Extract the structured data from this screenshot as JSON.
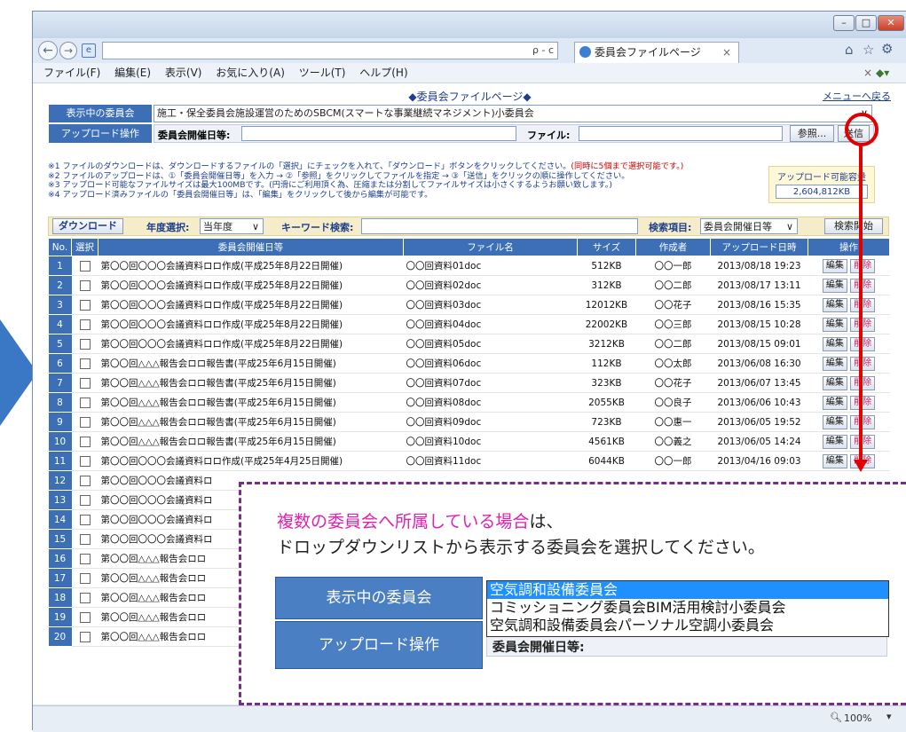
{
  "browser": {
    "tab_title": "委員会ファイルページ",
    "search_hint": "ρ - c",
    "menu": [
      "ファイル(F)",
      "編集(E)",
      "表示(V)",
      "お気に入り(A)",
      "ツール(T)",
      "ヘルプ(H)"
    ],
    "zoom": "100%"
  },
  "page": {
    "title": "◆委員会ファイルページ◆",
    "menu_link": "メニューへ戻る",
    "committee_label": "表示中の委員会",
    "committee_value": "施工・保全委員会施設運営のためのSBCM(スマートな事業継続マネジメント)小委員会",
    "upload_label": "アップロード操作",
    "meeting_date_label": "委員会開催日等:",
    "file_label": "ファイル:",
    "browse_button": "参照...",
    "send_button": "送信",
    "notes": [
      "※1 ファイルのダウンロードは、ダウンロードするファイルの「選択」にチェックを入れて、「ダウンロード」ボタンをクリックしてください。",
      "※2 ファイルのアップロードは、①「委員会開催日等」を入力 → ②「参照」をクリックしてファイルを指定 → ③「送信」をクリックの順に操作してください。",
      "※3 アップロード可能なファイルサイズは最大100MBです。(円滑にご利用頂く為、圧縮または分割してファイルサイズは小さくするようお願い致します。)",
      "※4 アップロード済みファイルの「委員会開催日等」は、「編集」をクリックして後から編集が可能です。"
    ],
    "note1_red": "(同時に5個まで選択可能です。)",
    "note3_red": "最大100MB",
    "capacity_label": "アップロード可能容量",
    "capacity_value": "2,604,812KB",
    "download_button": "ダウンロード",
    "year_label": "年度選択:",
    "year_value": "当年度",
    "keyword_label": "キーワード検索:",
    "search_item_label": "検索項目:",
    "search_item_value": "委員会開催日等",
    "search_button": "検索開始"
  },
  "table": {
    "headers": [
      "No.",
      "選択",
      "委員会開催日等",
      "ファイル名",
      "サイズ",
      "作成者",
      "アップロード日時",
      "操作"
    ],
    "edit_label": "編集",
    "delete_label": "削除",
    "rows": [
      {
        "no": "1",
        "title": "第〇〇回〇〇〇会議資料ロロ作成(平成25年8月22日開催)",
        "file": "〇〇回資料01doc",
        "size": "512KB",
        "author": "〇〇一郎",
        "date": "2013/08/18 19:23"
      },
      {
        "no": "2",
        "title": "第〇〇回〇〇〇会議資料ロロ作成(平成25年8月22日開催)",
        "file": "〇〇回資料02doc",
        "size": "312KB",
        "author": "〇〇二郎",
        "date": "2013/08/17 13:11"
      },
      {
        "no": "3",
        "title": "第〇〇回〇〇〇会議資料ロロ作成(平成25年8月22日開催)",
        "file": "〇〇回資料03doc",
        "size": "12012KB",
        "author": "〇〇花子",
        "date": "2013/08/16 15:35"
      },
      {
        "no": "4",
        "title": "第〇〇回〇〇〇会議資料ロロ作成(平成25年8月22日開催)",
        "file": "〇〇回資料04doc",
        "size": "22002KB",
        "author": "〇〇三郎",
        "date": "2013/08/15 10:28"
      },
      {
        "no": "5",
        "title": "第〇〇回〇〇〇会議資料ロロ作成(平成25年8月22日開催)",
        "file": "〇〇回資料05doc",
        "size": "3212KB",
        "author": "〇〇二郎",
        "date": "2013/08/15 09:01"
      },
      {
        "no": "6",
        "title": "第〇〇回△△△報告会ロロ報告書(平成25年6月15日開催)",
        "file": "〇〇回資料06doc",
        "size": "112KB",
        "author": "〇〇太郎",
        "date": "2013/06/08 16:30"
      },
      {
        "no": "7",
        "title": "第〇〇回△△△報告会ロロ報告書(平成25年6月15日開催)",
        "file": "〇〇回資料07doc",
        "size": "323KB",
        "author": "〇〇花子",
        "date": "2013/06/07 13:45"
      },
      {
        "no": "8",
        "title": "第〇〇回△△△報告会ロロ報告書(平成25年6月15日開催)",
        "file": "〇〇回資料08doc",
        "size": "2055KB",
        "author": "〇〇良子",
        "date": "2013/06/06 10:43"
      },
      {
        "no": "9",
        "title": "第〇〇回△△△報告会ロロ報告書(平成25年6月15日開催)",
        "file": "〇〇回資料09doc",
        "size": "723KB",
        "author": "〇〇惠一",
        "date": "2013/06/05 19:52"
      },
      {
        "no": "10",
        "title": "第〇〇回△△△報告会ロロ報告書(平成25年6月15日開催)",
        "file": "〇〇回資料10doc",
        "size": "4561KB",
        "author": "〇〇義之",
        "date": "2013/06/05 14:24"
      },
      {
        "no": "11",
        "title": "第〇〇回〇〇〇会議資料ロロ作成(平成25年4月25日開催)",
        "file": "〇〇回資料11doc",
        "size": "6044KB",
        "author": "〇〇一郎",
        "date": "2013/04/16 09:03"
      },
      {
        "no": "12",
        "title": "第〇〇回〇〇〇会議資料ロ",
        "file": "",
        "size": "",
        "author": "",
        "date": ""
      },
      {
        "no": "13",
        "title": "第〇〇回〇〇〇会議資料ロ",
        "file": "",
        "size": "",
        "author": "",
        "date": ""
      },
      {
        "no": "14",
        "title": "第〇〇回〇〇〇会議資料ロ",
        "file": "",
        "size": "",
        "author": "",
        "date": ""
      },
      {
        "no": "15",
        "title": "第〇〇回〇〇〇会議資料ロ",
        "file": "",
        "size": "",
        "author": "",
        "date": ""
      },
      {
        "no": "16",
        "title": "第〇〇回△△△報告会ロロ",
        "file": "",
        "size": "",
        "author": "",
        "date": ""
      },
      {
        "no": "17",
        "title": "第〇〇回△△△報告会ロロ",
        "file": "",
        "size": "",
        "author": "",
        "date": ""
      },
      {
        "no": "18",
        "title": "第〇〇回△△△報告会ロロ",
        "file": "",
        "size": "",
        "author": "",
        "date": ""
      },
      {
        "no": "19",
        "title": "第〇〇回△△△報告会ロロ",
        "file": "",
        "size": "",
        "author": "",
        "date": ""
      },
      {
        "no": "20",
        "title": "第〇〇回△△△報告会ロロ",
        "file": "",
        "size": "",
        "author": "",
        "date": ""
      }
    ]
  },
  "callout": {
    "line1_magenta": "複数の委員会へ所属している場合",
    "line1_rest": "は、",
    "line2": "ドロップダウンリストから表示する委員会を選択してください。",
    "zoom_label_committee": "表示中の委員会",
    "zoom_label_upload": "アップロード操作",
    "dropdown_options": [
      "空気調和設備委員会",
      "コミッショニング委員会BIM活用検討小委員会",
      "空気調和設備委員会パーソナル空調小委員会"
    ],
    "zoom_partial_text": "委員会開催日等:"
  },
  "colors": {
    "accent": "#3c6fb6",
    "highlight": "#e00000",
    "magenta": "#e020b0",
    "dash": "#7a2c8a"
  }
}
